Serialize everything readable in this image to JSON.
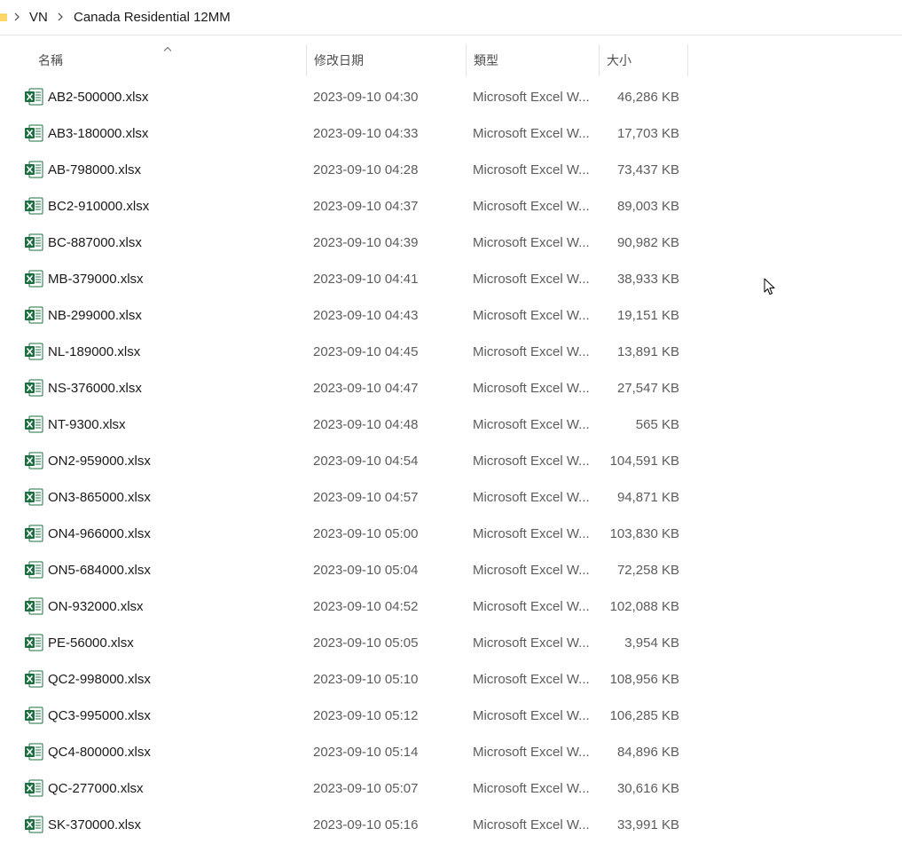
{
  "breadcrumb": {
    "items": [
      "VN",
      "Canada Residential 12MM"
    ]
  },
  "columns": {
    "name": "名稱",
    "date": "修改日期",
    "type": "類型",
    "size": "大小"
  },
  "files": [
    {
      "name": "AB2-500000.xlsx",
      "date": "2023-09-10 04:30",
      "type": "Microsoft Excel W...",
      "size": "46,286 KB"
    },
    {
      "name": "AB3-180000.xlsx",
      "date": "2023-09-10 04:33",
      "type": "Microsoft Excel W...",
      "size": "17,703 KB"
    },
    {
      "name": "AB-798000.xlsx",
      "date": "2023-09-10 04:28",
      "type": "Microsoft Excel W...",
      "size": "73,437 KB"
    },
    {
      "name": "BC2-910000.xlsx",
      "date": "2023-09-10 04:37",
      "type": "Microsoft Excel W...",
      "size": "89,003 KB"
    },
    {
      "name": "BC-887000.xlsx",
      "date": "2023-09-10 04:39",
      "type": "Microsoft Excel W...",
      "size": "90,982 KB"
    },
    {
      "name": "MB-379000.xlsx",
      "date": "2023-09-10 04:41",
      "type": "Microsoft Excel W...",
      "size": "38,933 KB"
    },
    {
      "name": "NB-299000.xlsx",
      "date": "2023-09-10 04:43",
      "type": "Microsoft Excel W...",
      "size": "19,151 KB"
    },
    {
      "name": "NL-189000.xlsx",
      "date": "2023-09-10 04:45",
      "type": "Microsoft Excel W...",
      "size": "13,891 KB"
    },
    {
      "name": "NS-376000.xlsx",
      "date": "2023-09-10 04:47",
      "type": "Microsoft Excel W...",
      "size": "27,547 KB"
    },
    {
      "name": "NT-9300.xlsx",
      "date": "2023-09-10 04:48",
      "type": "Microsoft Excel W...",
      "size": "565 KB"
    },
    {
      "name": "ON2-959000.xlsx",
      "date": "2023-09-10 04:54",
      "type": "Microsoft Excel W...",
      "size": "104,591 KB"
    },
    {
      "name": "ON3-865000.xlsx",
      "date": "2023-09-10 04:57",
      "type": "Microsoft Excel W...",
      "size": "94,871 KB"
    },
    {
      "name": "ON4-966000.xlsx",
      "date": "2023-09-10 05:00",
      "type": "Microsoft Excel W...",
      "size": "103,830 KB"
    },
    {
      "name": "ON5-684000.xlsx",
      "date": "2023-09-10 05:04",
      "type": "Microsoft Excel W...",
      "size": "72,258 KB"
    },
    {
      "name": "ON-932000.xlsx",
      "date": "2023-09-10 04:52",
      "type": "Microsoft Excel W...",
      "size": "102,088 KB"
    },
    {
      "name": "PE-56000.xlsx",
      "date": "2023-09-10 05:05",
      "type": "Microsoft Excel W...",
      "size": "3,954 KB"
    },
    {
      "name": "QC2-998000.xlsx",
      "date": "2023-09-10 05:10",
      "type": "Microsoft Excel W...",
      "size": "108,956 KB"
    },
    {
      "name": "QC3-995000.xlsx",
      "date": "2023-09-10 05:12",
      "type": "Microsoft Excel W...",
      "size": "106,285 KB"
    },
    {
      "name": "QC4-800000.xlsx",
      "date": "2023-09-10 05:14",
      "type": "Microsoft Excel W...",
      "size": "84,896 KB"
    },
    {
      "name": "QC-277000.xlsx",
      "date": "2023-09-10 05:07",
      "type": "Microsoft Excel W...",
      "size": "30,616 KB"
    },
    {
      "name": "SK-370000.xlsx",
      "date": "2023-09-10 05:16",
      "type": "Microsoft Excel W...",
      "size": "33,991 KB"
    }
  ],
  "icons": {
    "folder": "folder-icon",
    "file": "excel-file-icon",
    "cursor": "mouse-cursor-icon",
    "separator": "chevron-right-icon",
    "sort": "sort-ascending-icon"
  },
  "colors": {
    "excel_green": "#1d6f42",
    "folder_yellow": "#f8c53a"
  }
}
